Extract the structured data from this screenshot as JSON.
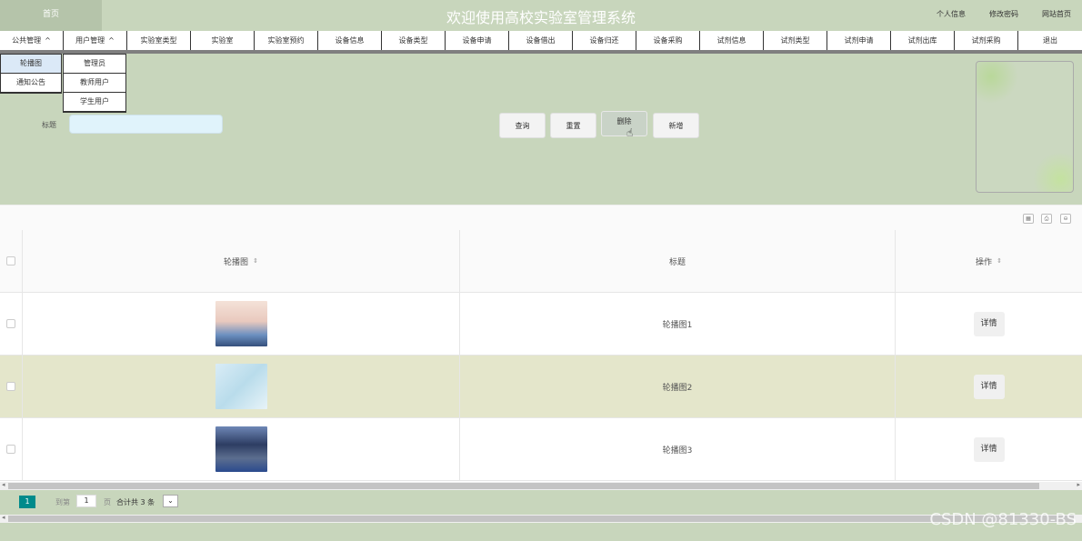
{
  "header": {
    "home_tab": "首页",
    "title": "欢迎使用高校实验室管理系统",
    "links": [
      "个人信息",
      "修改密码",
      "网站首页"
    ]
  },
  "nav": {
    "items": [
      {
        "label": "公共管理",
        "caret": "^"
      },
      {
        "label": "用户管理",
        "caret": "^"
      },
      {
        "label": "实验室类型"
      },
      {
        "label": "实验室"
      },
      {
        "label": "实验室预约"
      },
      {
        "label": "设备信息"
      },
      {
        "label": "设备类型"
      },
      {
        "label": "设备申请"
      },
      {
        "label": "设备借出"
      },
      {
        "label": "设备归还"
      },
      {
        "label": "设备采购"
      },
      {
        "label": "试剂信息"
      },
      {
        "label": "试剂类型"
      },
      {
        "label": "试剂申请"
      },
      {
        "label": "试剂出库"
      },
      {
        "label": "试剂采购"
      },
      {
        "label": "退出"
      }
    ],
    "public_menu": [
      "轮播图",
      "通知公告"
    ],
    "user_menu": [
      "管理员",
      "教师用户",
      "学生用户"
    ]
  },
  "search": {
    "label": "标题",
    "value": "",
    "buttons": {
      "query": "查询",
      "reset": "重置",
      "delete": "删除",
      "add": "新增"
    }
  },
  "toolbar": {
    "icons": [
      "grid-icon",
      "print-icon",
      "export-icon"
    ],
    "glyphs": [
      "▦",
      "⎙",
      "⊖"
    ]
  },
  "table": {
    "headers": {
      "image": "轮播图",
      "title": "标题",
      "op": "操作"
    },
    "sort_glyph": "⇕",
    "rows": [
      {
        "title": "轮播图1",
        "op": "详情"
      },
      {
        "title": "轮播图2",
        "op": "详情"
      },
      {
        "title": "轮播图3",
        "op": "详情"
      }
    ]
  },
  "pager": {
    "current": "1",
    "goto_label": "到第",
    "goto_value": "1",
    "page_unit": "页",
    "total": "合计共 3 条",
    "select_glyph": "⌄"
  },
  "watermark": "CSDN @81330-BS",
  "colors": {
    "theme": "#c8d6bc",
    "page_active": "#008b8b",
    "row_alt": "#e4e6cb"
  }
}
